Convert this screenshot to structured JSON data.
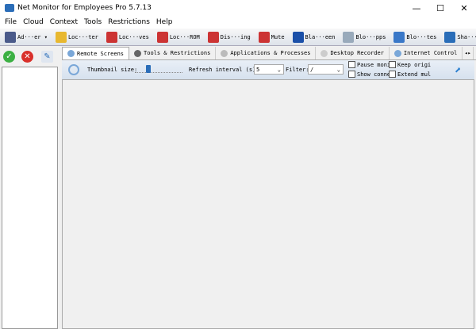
{
  "window": {
    "title": "Net Monitor for Employees Pro 5.7.13",
    "minimize": "—",
    "maximize": "☐",
    "close": "✕"
  },
  "menu": [
    "File",
    "Cloud",
    "Context",
    "Tools",
    "Restrictions",
    "Help"
  ],
  "toolbar": [
    {
      "label": "Ad···er ▾",
      "icon": "add-computer-icon",
      "color": "#4a5a8a"
    },
    {
      "label": "Loc···ter",
      "icon": "lock-icon",
      "color": "#e8b830"
    },
    {
      "label": "Loc···ves",
      "icon": "lock-drives-icon",
      "color": "#cc3333"
    },
    {
      "label": "Loc···ROM",
      "icon": "lock-cdrom-icon",
      "color": "#cc3333"
    },
    {
      "label": "Dis···ing",
      "icon": "disable-printing-icon",
      "color": "#cc3333"
    },
    {
      "label": "Mute",
      "icon": "mute-icon",
      "color": "#cc3333"
    },
    {
      "label": "Bla···een",
      "icon": "black-screen-icon",
      "color": "#1a4fa8"
    },
    {
      "label": "Blo···pps",
      "icon": "block-apps-icon",
      "color": "#9ab"
    },
    {
      "label": "Blo···tes",
      "icon": "block-websites-icon",
      "color": "#3a78c8"
    },
    {
      "label": "Sha···top",
      "icon": "share-desktop-icon",
      "color": "#2a6db8"
    }
  ],
  "tabs": [
    "Remote Screens",
    "Tools & Restrictions",
    "Applications & Processes",
    "Desktop Recorder",
    "Internet Control"
  ],
  "options": {
    "thumbnail_label": "Thumbnail size:",
    "thumbnail_value": 0.25,
    "refresh_label": "Refresh interval (s):",
    "refresh_value": "5",
    "filter_label": "Filter:",
    "filter_value": "/",
    "checkboxes": [
      "Pause moni",
      "Keep origi",
      "Show conne",
      "Extend mul"
    ]
  }
}
